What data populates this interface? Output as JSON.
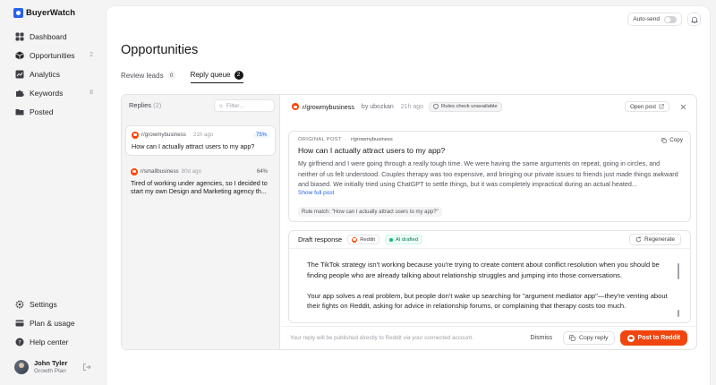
{
  "brand": {
    "name": "BuyerWatch",
    "color": "#2563eb"
  },
  "nav": {
    "items": [
      {
        "label": "Dashboard",
        "icon": "grid-icon",
        "count": ""
      },
      {
        "label": "Opportunities",
        "icon": "cube-icon",
        "count": "2"
      },
      {
        "label": "Analytics",
        "icon": "chart-icon",
        "count": ""
      },
      {
        "label": "Keywords",
        "icon": "puzzle-icon",
        "count": "8"
      },
      {
        "label": "Posted",
        "icon": "folder-icon",
        "count": ""
      }
    ],
    "bottom": [
      {
        "label": "Settings",
        "icon": "gear-icon"
      },
      {
        "label": "Plan & usage",
        "icon": "card-icon"
      },
      {
        "label": "Help center",
        "icon": "help-icon"
      }
    ]
  },
  "user": {
    "name": "John Tyler",
    "plan": "Growth Plan"
  },
  "topbar": {
    "autosend_label": "Auto-send"
  },
  "page": {
    "title": "Opportunities",
    "tabs": [
      {
        "label": "Review leads",
        "count": "0"
      },
      {
        "label": "Reply queue",
        "count": "2"
      }
    ]
  },
  "replies": {
    "heading": "Replies",
    "count": "(2)",
    "filter_placeholder": "Filter...",
    "items": [
      {
        "subreddit": "r/growmybusiness",
        "time": "21h ago",
        "score": "75%",
        "title": "How can I actually attract users to my app?"
      },
      {
        "subreddit": "r/smallbusiness",
        "time": "80d ago",
        "score": "64%",
        "title": "Tired of working under agencies, so I decided to start my own Design and Marketing agency th..."
      }
    ]
  },
  "detail": {
    "subreddit": "r/growmybusiness",
    "author": "by ubozkan",
    "time": "21h ago",
    "rules_status": "Rules check unavailable",
    "open_post": "Open post",
    "original": {
      "label": "ORIGINAL POST",
      "subreddit": "r/growmybusiness",
      "copy": "Copy",
      "title": "How can I actually attract users to my app?",
      "body": "My girlfriend and I were going through a really tough time. We were having the same arguments on repeat, going in circles, and neither of us felt understood. Couples therapy was too expensive, and bringing our private issues to friends just made things awkward and biased. We initially tried using ChatGPT to settle things, but it was completely impractical during an actual heated...",
      "show_full": "Show full post",
      "rule_match": "Rule match: \"How can I actually attract users to my app?\""
    },
    "draft": {
      "title": "Draft response",
      "platform": "Reddit",
      "ai_badge": "AI drafted",
      "regenerate": "Regenerate",
      "text": "The TikTok strategy isn't working because you're trying to create content about conflict resolution when you should be finding people who are already talking about relationship struggles and jumping into those conversations.\n\nYour app solves a real problem, but people don't wake up searching for \"argument mediator app\"—they're venting about their fights on Reddit, asking for advice in relationship forums, or complaining that therapy costs too much."
    },
    "footer": {
      "note": "Your reply will be published directly to Reddit via your connected account.",
      "dismiss": "Dismiss",
      "copy_reply": "Copy reply",
      "post": "Post to Reddit"
    }
  },
  "colors": {
    "reddit": "#ff4500",
    "post_button": "#f0460e",
    "score_blue": "#2563eb",
    "ai_green": "#10b981"
  }
}
